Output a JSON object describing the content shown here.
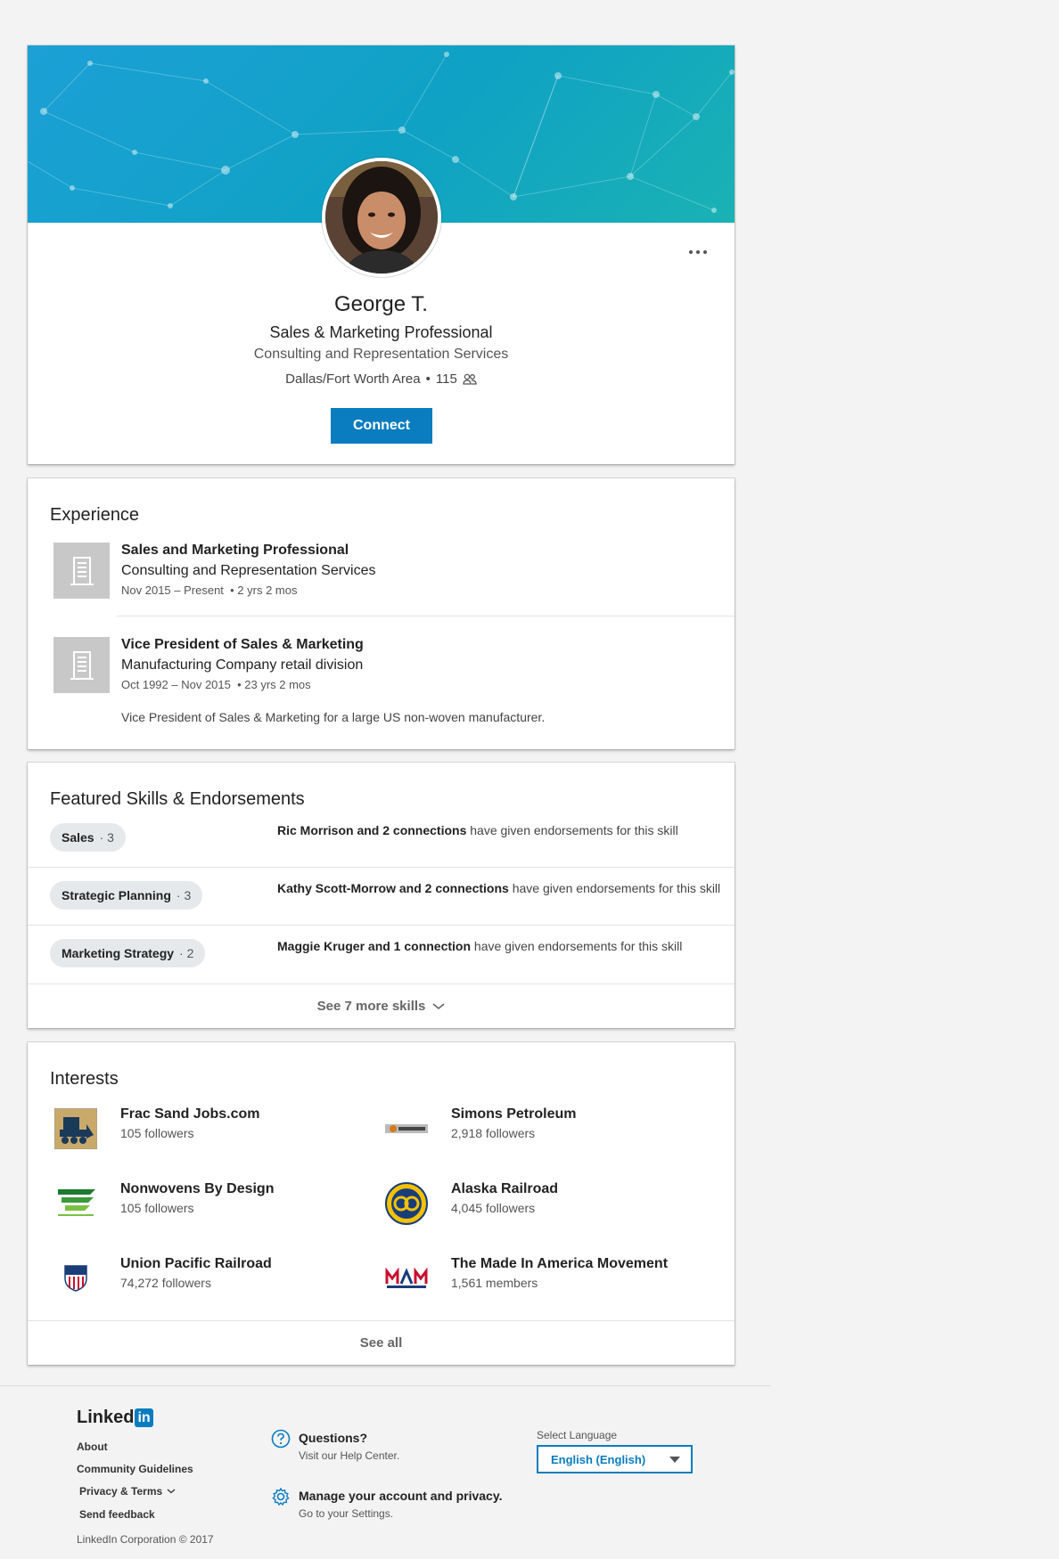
{
  "profile": {
    "name": "George T.",
    "headline": "Sales & Marketing Professional",
    "company": "Consulting and Representation Services",
    "location": "Dallas/Fort Worth Area",
    "separator": "•",
    "connections": "115",
    "connect_label": "Connect"
  },
  "experience": {
    "title": "Experience",
    "items": [
      {
        "role": "Sales and Marketing Professional",
        "company": "Consulting and Representation Services",
        "dates": "Nov 2015 – Present",
        "duration": "2 yrs 2 mos",
        "description": ""
      },
      {
        "role": "Vice President of Sales & Marketing",
        "company": "Manufacturing Company retail division",
        "dates": "Oct 1992 – Nov 2015",
        "duration": "23 yrs 2 mos",
        "description": "Vice President of Sales & Marketing for a large US non-woven manufacturer."
      }
    ]
  },
  "skills": {
    "title": "Featured Skills & Endorsements",
    "items": [
      {
        "name": "Sales",
        "count": "3",
        "endorsers": "Ric Morrison and 2 connections",
        "suffix": "have given endorsements for this skill"
      },
      {
        "name": "Strategic Planning",
        "count": "3",
        "endorsers": "Kathy Scott-Morrow and 2 connections",
        "suffix": "have given endorsements for this skill"
      },
      {
        "name": "Marketing Strategy",
        "count": "2",
        "endorsers": "Maggie Kruger and 1 connection",
        "suffix": "have given endorsements for this skill"
      }
    ],
    "see_more_label": "See 7 more skills"
  },
  "interests": {
    "title": "Interests",
    "items": [
      {
        "name": "Frac Sand Jobs.com",
        "count": "105 followers",
        "icon": "bulldozer-logo"
      },
      {
        "name": "Simons Petroleum",
        "count": "2,918 followers",
        "icon": "simons-logo"
      },
      {
        "name": "Nonwovens By Design",
        "count": "105 followers",
        "icon": "nonwovens-logo"
      },
      {
        "name": "Alaska Railroad",
        "count": "4,045 followers",
        "icon": "alaska-railroad-logo"
      },
      {
        "name": "Union Pacific Railroad",
        "count": "74,272 followers",
        "icon": "union-pacific-shield"
      },
      {
        "name": "The Made In America Movement",
        "count": "1,561 members",
        "icon": "mam-logo"
      }
    ],
    "see_all_label": "See all"
  },
  "footer": {
    "logo_text": "Linked",
    "logo_in": "in",
    "links": [
      "About",
      "Community Guidelines",
      "Privacy & Terms",
      "Send feedback"
    ],
    "copyright": "LinkedIn Corporation © 2017",
    "help_title": "Questions?",
    "help_sub": "Visit our Help Center.",
    "settings_title": "Manage your account and privacy.",
    "settings_sub": "Go to your Settings.",
    "language_label": "Select Language",
    "language_value": "English (English)"
  },
  "colors": {
    "brand": "#0a7cc0",
    "banner": "#1ca0d6"
  }
}
